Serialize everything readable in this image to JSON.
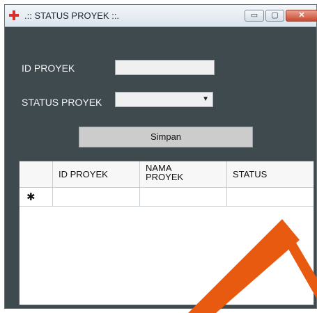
{
  "window": {
    "title": ".:: STATUS PROYEK ::.",
    "minimize_glyph": "▭",
    "maximize_glyph": "▢",
    "close_glyph": "✕"
  },
  "form": {
    "id_label": "ID PROYEK",
    "id_value": "",
    "status_label": "STATUS PROYEK",
    "status_selected": "",
    "save_label": "Simpan"
  },
  "grid": {
    "columns": [
      "ID PROYEK",
      "NAMA\nPROYEK",
      "STATUS"
    ],
    "rows": [
      {
        "marker": "✱",
        "cells": [
          "",
          "",
          ""
        ]
      }
    ]
  },
  "icons": {
    "app": "red-cross-icon",
    "dropdown": "chevron-down-icon"
  },
  "colors": {
    "window_bg": "#3f4a4f",
    "button_bg": "#cccccc",
    "watermark": "#e85a10"
  }
}
